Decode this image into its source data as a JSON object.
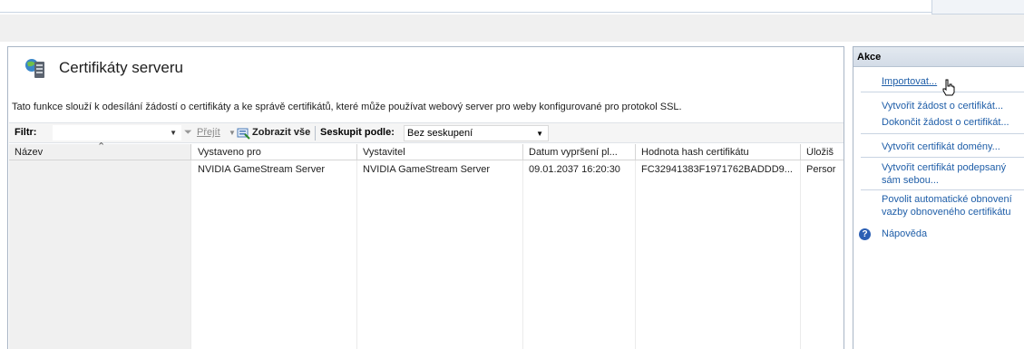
{
  "header": {
    "title": "Certifikáty serveru",
    "description": "Tato funkce slouží k odesílání žádostí o certifikáty a ke správě certifikátů, které může používat webový server pro weby konfigurované pro protokol SSL."
  },
  "toolbar": {
    "filter_label": "Filtr:",
    "filter_value": "",
    "go_label": "Přejít",
    "show_all_label": "Zobrazit vše",
    "group_by_label": "Seskupit podle:",
    "group_by_value": "Bez seskupení"
  },
  "table": {
    "columns": [
      "Název",
      "Vystaveno pro",
      "Vystavitel",
      "Datum vypršení pl...",
      "Hodnota hash certifikátu",
      "Úložiš"
    ],
    "rows": [
      [
        "",
        "NVIDIA GameStream Server",
        "NVIDIA GameStream Server",
        "09.01.2037 16:20:30",
        "FC32941383F1971762BADDD9...",
        "Persor"
      ]
    ]
  },
  "actions": {
    "title": "Akce",
    "items": [
      "Importovat...",
      "Vytvořit žádost o certifikát...",
      "Dokončit žádost o certifikát...",
      "Vytvořit certifikát domény...",
      "Vytvořit certifikát podepsaný",
      "sám sebou...",
      "Povolit automatické obnovení",
      "vazby obnoveného certifikátu",
      "Nápověda"
    ]
  },
  "colors": {
    "link": "#1f5ea8",
    "panel_border": "#a9b6c6",
    "header_gradient": "#d3dce7"
  }
}
